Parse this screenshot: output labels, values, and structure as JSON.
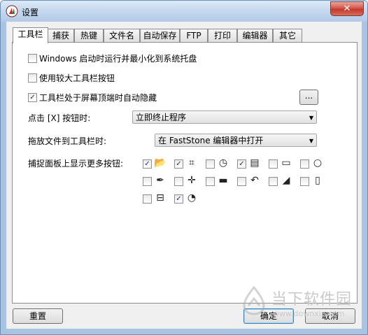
{
  "window": {
    "title": "设置",
    "close_label": "✕"
  },
  "tabs": [
    {
      "label": "工具栏",
      "active": true
    },
    {
      "label": "捕获",
      "active": false
    },
    {
      "label": "热键",
      "active": false
    },
    {
      "label": "文件名",
      "active": false
    },
    {
      "label": "自动保存",
      "active": false
    },
    {
      "label": "FTP",
      "active": false
    },
    {
      "label": "打印",
      "active": false
    },
    {
      "label": "编辑器",
      "active": false
    },
    {
      "label": "其它",
      "active": false
    }
  ],
  "options": [
    {
      "label": "Windows 启动时运行并最小化到系统托盘",
      "checked": false
    },
    {
      "label": "使用较大工具栏按钮",
      "checked": false
    },
    {
      "label": "工具栏处于屏幕顶端时自动隐藏",
      "checked": true
    }
  ],
  "more_button_label": "...",
  "close_click": {
    "label": "点击 [X] 按钮时:",
    "value": "立即终止程序"
  },
  "drag_drop": {
    "label": "拖放文件到工具栏时:",
    "value": "在 FastStone 编辑器中打开"
  },
  "capture_panel": {
    "label": "捕捉面板上显示更多按钮:",
    "items": [
      {
        "icon": "open-folder-icon",
        "glyph": "📂",
        "checked": true
      },
      {
        "icon": "crop-frame-icon",
        "glyph": "⌗",
        "checked": true
      },
      {
        "icon": "clock-icon",
        "glyph": "◷",
        "checked": false
      },
      {
        "icon": "film-icon",
        "glyph": "▤",
        "checked": true
      },
      {
        "icon": "rectangle-icon",
        "glyph": "▭",
        "checked": false
      },
      {
        "icon": "magnifier-icon",
        "glyph": "○",
        "checked": false
      },
      {
        "icon": "color-picker-icon",
        "glyph": "✒",
        "checked": false
      },
      {
        "icon": "crosshair-icon",
        "glyph": "✛",
        "checked": false
      },
      {
        "icon": "ruler-icon",
        "glyph": "▬",
        "checked": false
      },
      {
        "icon": "undo-icon",
        "glyph": "↶",
        "checked": false
      },
      {
        "icon": "draw-icon",
        "glyph": "◢",
        "checked": false
      },
      {
        "icon": "pdf-icon",
        "glyph": "▯",
        "checked": false
      },
      {
        "icon": "layout-icon",
        "glyph": "⊟",
        "checked": false
      },
      {
        "icon": "timer-icon",
        "glyph": "◔",
        "checked": true
      }
    ]
  },
  "buttons": {
    "reset": "重置",
    "ok": "确定",
    "cancel": "取消"
  },
  "watermark": {
    "text": "当下软件园",
    "url": "www.downxia.com"
  }
}
